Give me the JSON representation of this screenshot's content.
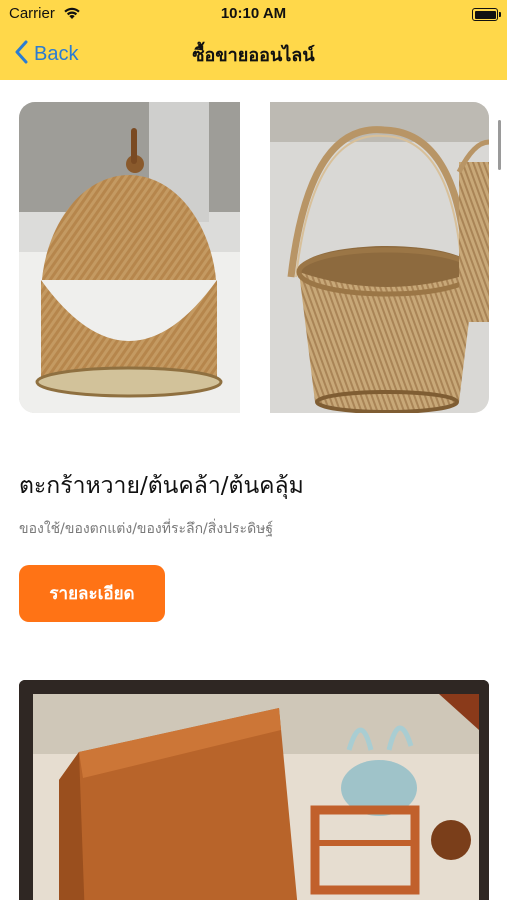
{
  "status_bar": {
    "carrier": "Carrier",
    "time": "10:10 AM"
  },
  "nav": {
    "back_label": "Back",
    "title": "ซื้อขายออนไลน์"
  },
  "items": [
    {
      "title": "ตะกร้าหวาย/ต้นคล้า/ต้นคลุ้ม",
      "subtitle": "ของใช้/ของตกแต่ง/ของที่ระลึก/สิ่งประดิษฐ์",
      "button_label": "รายละเอียด"
    }
  ],
  "colors": {
    "nav_background": "#ffd84a",
    "accent_button": "#ff7315",
    "back_link": "#2b7cd3"
  }
}
